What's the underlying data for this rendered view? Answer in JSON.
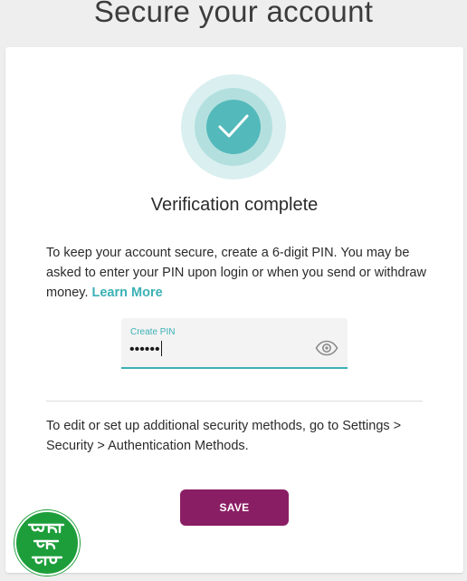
{
  "page": {
    "title": "Secure your account"
  },
  "verification": {
    "heading": "Verification complete",
    "description": "To keep your account secure, create a 6-digit PIN. You may be asked to enter your PIN upon login or when you send or withdraw money. ",
    "learn_more": "Learn More"
  },
  "pin_field": {
    "label": "Create PIN",
    "value": "••••••"
  },
  "note": "To edit or set up additional security methods, go to Settings > Security > Authentication Methods.",
  "save_button": "SAVE",
  "colors": {
    "accent": "#3bb1b6",
    "primary_button": "#8a1e64",
    "badge_inner": "#53b9ba",
    "logo_bg": "#1d9e3a"
  },
  "icons": {
    "badge": "checkmark-icon",
    "pin_toggle": "eye-icon"
  },
  "watermark": {
    "text": "এসো আয় করি"
  }
}
